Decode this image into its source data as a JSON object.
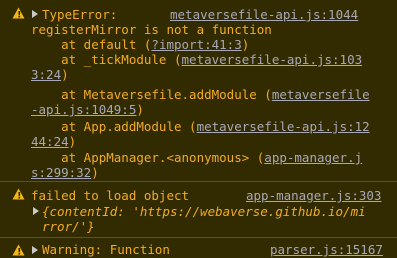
{
  "console": {
    "messages": [
      {
        "type": "warning",
        "lines": {
          "l1_text": "TypeError: ",
          "l1_src": "metaversefile-api.js:1044",
          "l2": "registerMirror is not a function",
          "l3_pre": "    at default (",
          "l3_link": "?import:41:3",
          "l3_post": ")",
          "l4_pre": "    at _tickModule (",
          "l4_link_a": "metaversefile-api.js:103",
          "l5_link_b": "3:24",
          "l5_post": ")",
          "l6_pre": "    at Metaversefile.addModule (",
          "l6_link_a": "metaversefile",
          "l7_link_b": "-api.js:1049:5",
          "l7_post": ")",
          "l8_pre": "    at App.addModule (",
          "l8_link_a": "metaversefile-api.js:12",
          "l9_link_b": "44:24",
          "l9_post": ")",
          "l10_pre": "    at AppManager.<anonymous> (",
          "l10_link_a": "app-manager.j",
          "l11_link_b": "s:299:32",
          "l11_post": ")"
        }
      },
      {
        "type": "warning",
        "text": "failed to load object",
        "source": "app-manager.js:303",
        "obj_open": "{",
        "obj_key": "contentId",
        "obj_colon": ": ",
        "obj_value_a": "'https://webaverse.github.io/mi",
        "obj_value_b": "rror/'",
        "obj_close": "}"
      },
      {
        "type": "warning",
        "text": "Warning: Function",
        "source": "parser.js:15167"
      }
    ]
  },
  "colors": {
    "background": "#332b00",
    "warning_text": "#f2ab26",
    "link": "#a8a8b8",
    "separator": "#665500"
  },
  "icons": [
    "warning-icon",
    "expand-arrow-icon"
  ]
}
